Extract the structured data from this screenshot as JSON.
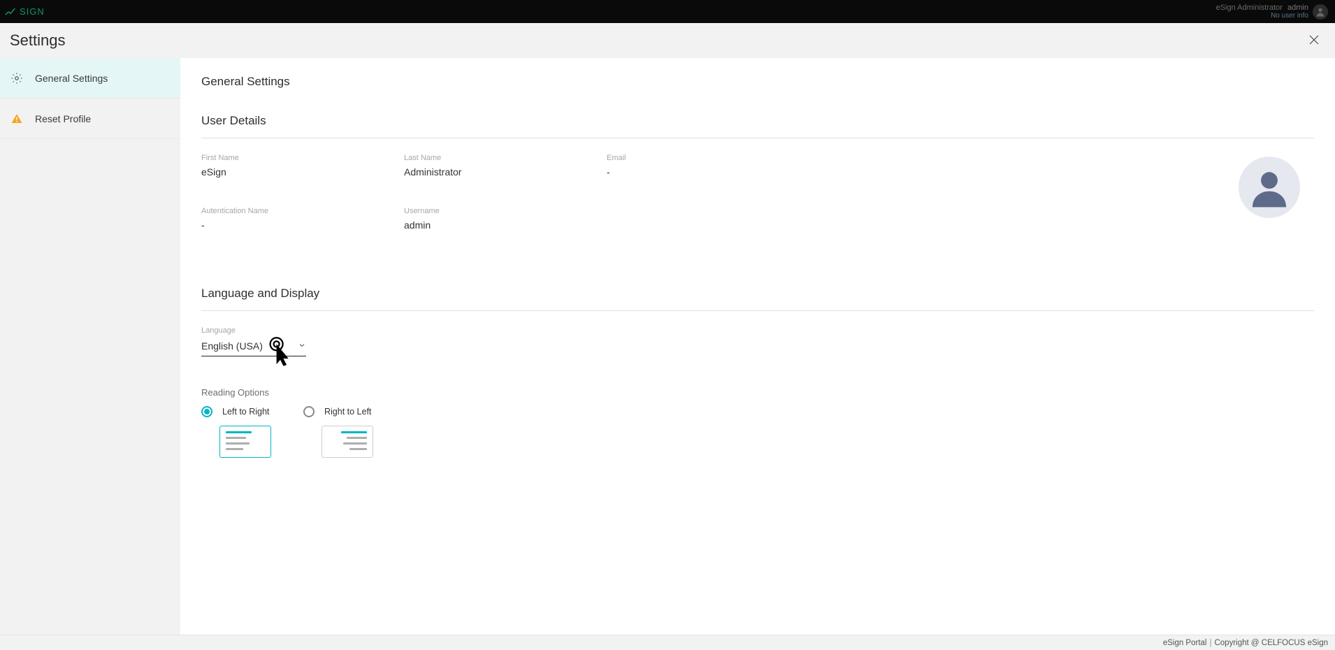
{
  "topbar": {
    "logo_text": "SIGN",
    "account_role": "eSign Administrator",
    "account_user": "admin",
    "account_info": "No user info"
  },
  "titlebar": {
    "title": "Settings"
  },
  "sidebar": {
    "items": [
      {
        "label": "General Settings"
      },
      {
        "label": "Reset Profile"
      }
    ]
  },
  "content": {
    "page_title": "General Settings",
    "user_details_title": "User Details",
    "fields": {
      "first_name_label": "First Name",
      "first_name_value": "eSign",
      "last_name_label": "Last Name",
      "last_name_value": "Administrator",
      "email_label": "Email",
      "email_value": "-",
      "auth_name_label": "Autentication Name",
      "auth_name_value": "-",
      "username_label": "Username",
      "username_value": "admin"
    },
    "lang_section_title": "Language and Display",
    "language_label": "Language",
    "language_value": "English (USA)",
    "reading_label": "Reading Options",
    "reading_ltr": "Left to Right",
    "reading_rtl": "Right to Left"
  },
  "footer": {
    "product": "eSign Portal",
    "copyright": "Copyright @ CELFOCUS eSign"
  }
}
